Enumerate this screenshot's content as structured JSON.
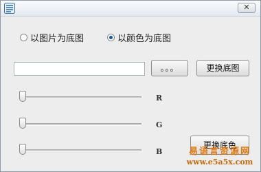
{
  "window": {
    "close_label": "✕"
  },
  "background_mode": {
    "options": [
      {
        "label": "以图片为底图",
        "checked": false
      },
      {
        "label": "以颜色为底图",
        "checked": true
      }
    ]
  },
  "image_path": {
    "value": ""
  },
  "buttons": {
    "browse_label": "。。。",
    "change_image_label": "更换底图",
    "change_color_label": "更换底色"
  },
  "color_sliders": [
    {
      "label": "R",
      "value": 0
    },
    {
      "label": "G",
      "value": 0
    },
    {
      "label": "B",
      "value": 0
    }
  ],
  "watermark": {
    "line1": "易语言资源网",
    "line2": "www.e5a5x.com"
  },
  "colors": {
    "window_bg": "#ededed",
    "radio_checked": "#1b4fa2",
    "watermark": "#e07a10"
  }
}
